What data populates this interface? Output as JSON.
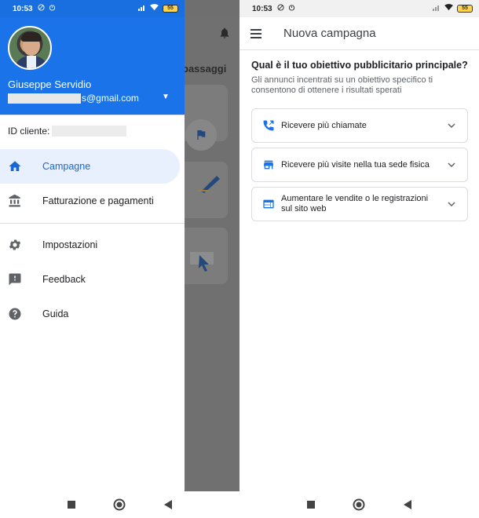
{
  "left_screen": {
    "status_bar": {
      "time": "10:53",
      "battery": "55"
    },
    "background_app": {
      "title_fragment": "passaggi"
    },
    "drawer": {
      "user_name": "Giuseppe Servidio",
      "email_suffix": "s@gmail.com",
      "client_id_label": "ID cliente:",
      "items": [
        {
          "label": "Campagne",
          "icon": "home-icon",
          "active": true
        },
        {
          "label": "Fatturazione e pagamenti",
          "icon": "bank-icon",
          "active": false
        },
        {
          "label": "Impostazioni",
          "icon": "gear-icon",
          "active": false
        },
        {
          "label": "Feedback",
          "icon": "feedback-icon",
          "active": false
        },
        {
          "label": "Guida",
          "icon": "help-icon",
          "active": false
        }
      ]
    }
  },
  "right_screen": {
    "status_bar": {
      "time": "10:53",
      "battery": "55"
    },
    "app_bar": {
      "title": "Nuova campagna"
    },
    "question": "Qual è il tuo obiettivo pubblicitario principale?",
    "question_sub": "Gli annunci incentrati su un obiettivo specifico ti consentono di ottenere i risultati sperati",
    "options": [
      {
        "label": "Ricevere più chiamate",
        "icon": "phone-call-icon"
      },
      {
        "label": "Ricevere più visite nella tua sede fisica",
        "icon": "store-icon"
      },
      {
        "label": "Aumentare le vendite o le registrazioni sul sito web",
        "icon": "web-icon"
      }
    ]
  },
  "colors": {
    "brand_blue": "#1a73e8",
    "active_bg": "#e8f0fe",
    "active_text": "#1967d2",
    "battery": "#ffd54f"
  }
}
